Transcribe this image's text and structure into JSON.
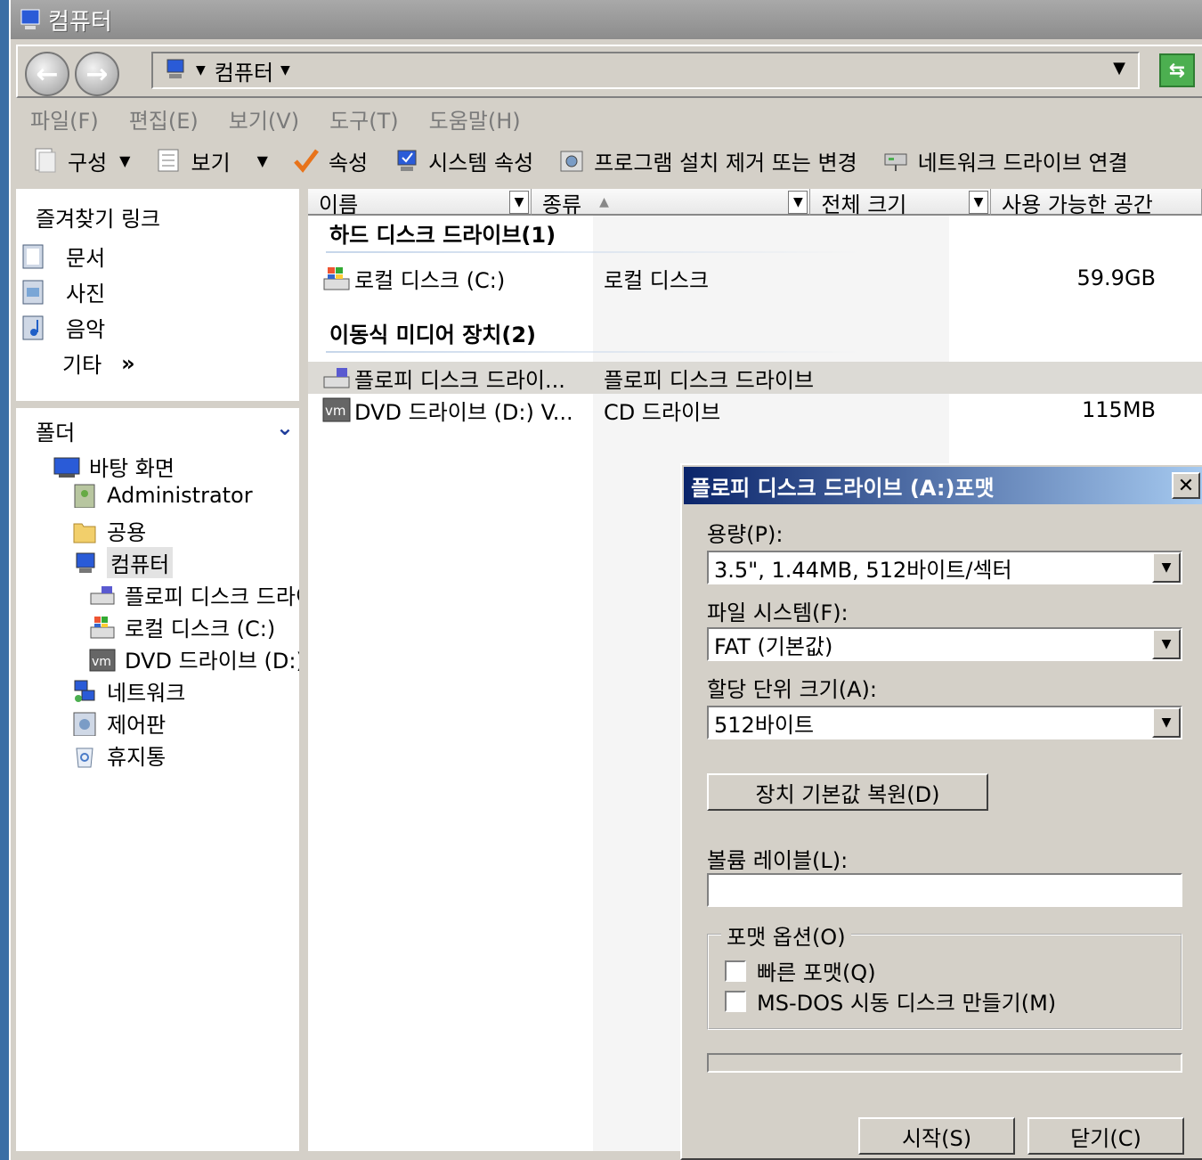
{
  "window": {
    "title": "컴퓨터"
  },
  "address": {
    "crumb": "컴퓨터"
  },
  "menu": [
    "파일(F)",
    "편집(E)",
    "보기(V)",
    "도구(T)",
    "도움말(H)"
  ],
  "toolbar": {
    "organize": "구성",
    "view": "보기",
    "properties": "속성",
    "system_properties": "시스템 속성",
    "uninstall": "프로그램 설치 제거 또는 변경",
    "map_drive": "네트워크 드라이브 연결"
  },
  "favorites": {
    "header": "즐겨찾기 링크",
    "items": [
      "문서",
      "사진",
      "음악"
    ],
    "more": "기타",
    "more_chevron": "»"
  },
  "folders": {
    "header": "폴더",
    "tree": [
      "바탕 화면",
      "Administrator",
      "공용",
      "컴퓨터",
      "플로피 디스크 드라이브",
      "로컬 디스크 (C:)",
      "DVD 드라이브 (D:)",
      "네트워크",
      "제어판",
      "휴지통"
    ]
  },
  "columns": {
    "name": "이름",
    "type": "종류",
    "total": "전체 크기",
    "free": "사용 가능한 공간"
  },
  "groups": {
    "hdd": "하드 디스크 드라이브(1)",
    "removable": "이동식 미디어 장치(2)"
  },
  "drives": [
    {
      "name": "로컬 디스크 (C:)",
      "type": "로컬 디스크",
      "size": "59.9GB"
    },
    {
      "name": "플로피 디스크 드라이...",
      "type": "플로피 디스크 드라이브",
      "size": ""
    },
    {
      "name": "DVD 드라이브 (D:) V...",
      "type": "CD 드라이브",
      "size": "115MB"
    }
  ],
  "dialog": {
    "title": "플로피 디스크 드라이브 (A:)포맷",
    "close": "✕",
    "capacity_label": "용량(P):",
    "capacity_value": "3.5\",  1.44MB, 512바이트/섹터",
    "fs_label": "파일 시스템(F):",
    "fs_value": "FAT (기본값)",
    "alloc_label": "할당 단위 크기(A):",
    "alloc_value": "512바이트",
    "restore_defaults": "장치 기본값 복원(D)",
    "volume_label": "볼륨 레이블(L):",
    "volume_value": "",
    "options_legend": "포맷 옵션(O)",
    "quick_format": "빠른 포맷(Q)",
    "msdos_boot": "MS-DOS 시동 디스크 만들기(M)",
    "quick_format_checked": false,
    "msdos_checked": false,
    "progress": 0,
    "start": "시작(S)",
    "close_button": "닫기(C)"
  }
}
